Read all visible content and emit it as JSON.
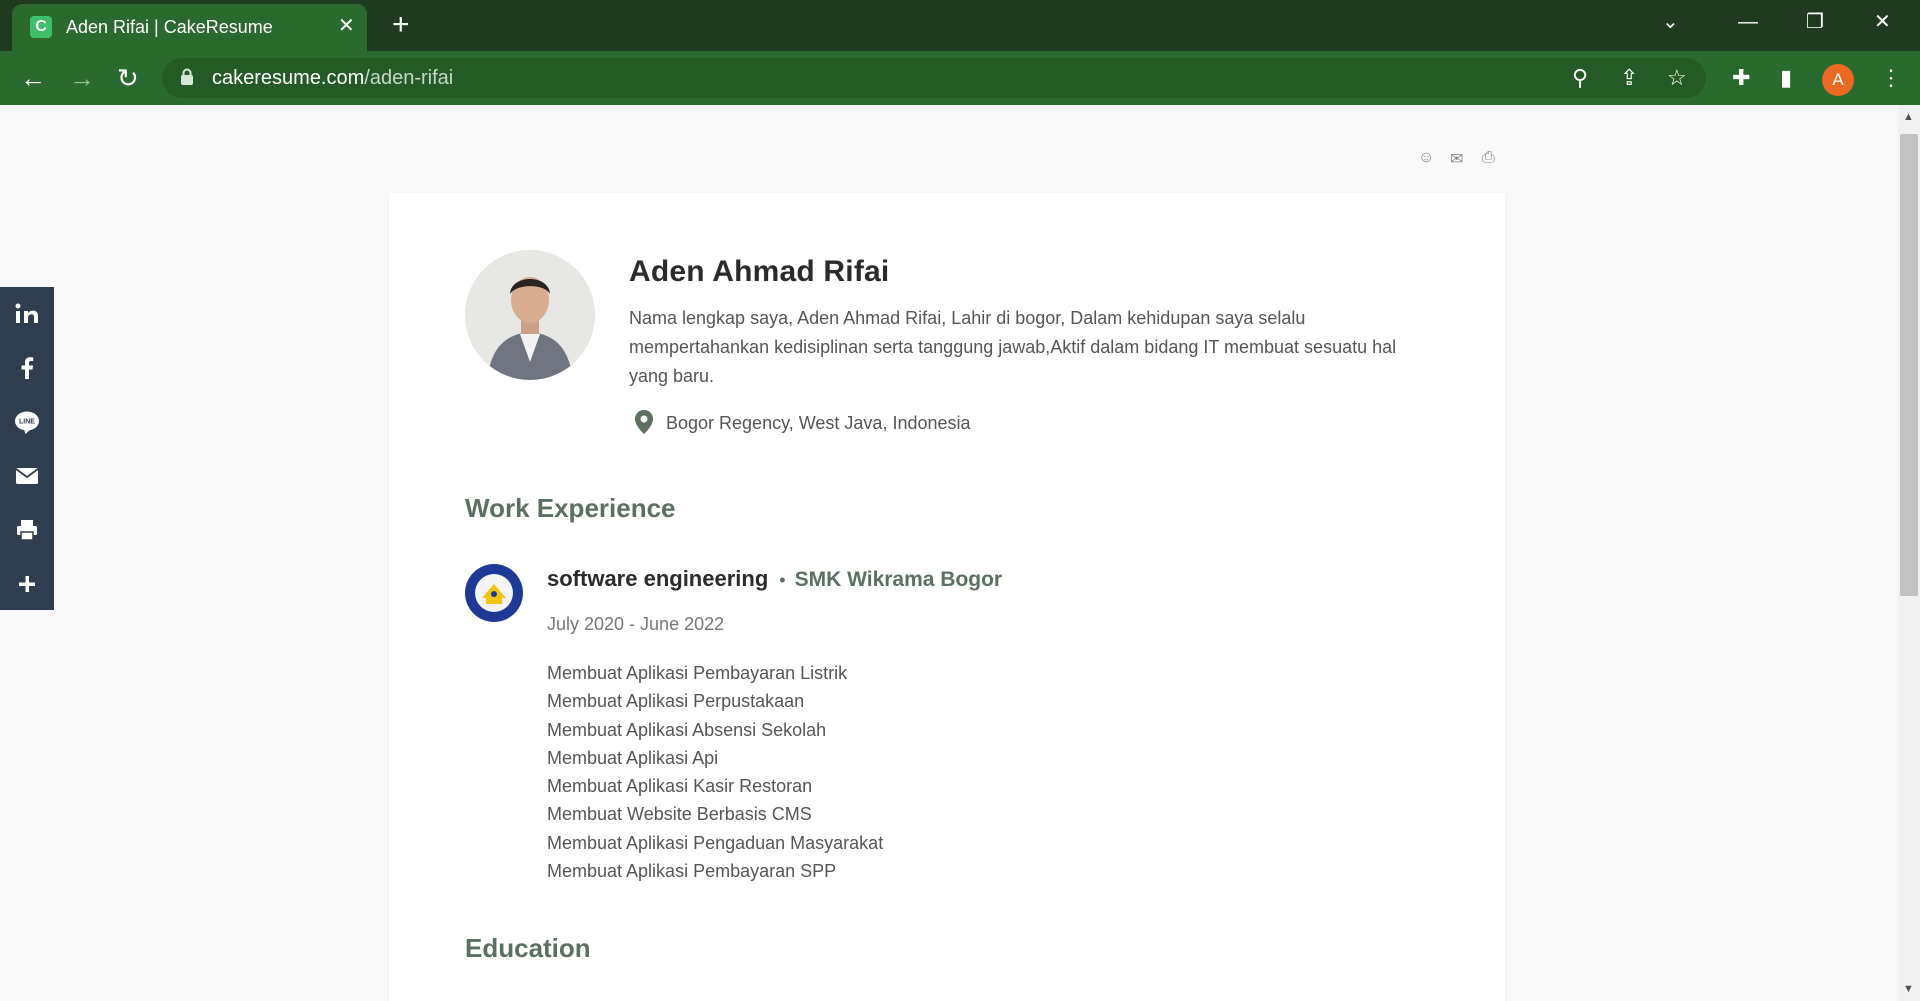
{
  "browser": {
    "tab_title": "Aden Rifai | CakeResume",
    "tab_favicon_letter": "C",
    "url_host": "cakeresume.com",
    "url_path": "/aden-rifai",
    "profile_initial": "A"
  },
  "profile": {
    "name": "Aden Ahmad Rifai",
    "bio": "Nama lengkap saya, Aden Ahmad Rifai, Lahir di bogor, Dalam kehidupan saya selalu mempertahankan kedisiplinan serta tanggung jawab,Aktif dalam bidang IT membuat sesuatu hal yang baru.",
    "location": "Bogor Regency, West Java, Indonesia"
  },
  "sections": {
    "work_title": "Work Experience",
    "education_title": "Education"
  },
  "job": {
    "title": "software engineering",
    "company": "SMK Wikrama Bogor",
    "dates": "July 2020 - June 2022",
    "duties": [
      "Membuat Aplikasi Pembayaran Listrik",
      "Membuat Aplikasi Perpustakaan",
      "Membuat Aplikasi Absensi Sekolah",
      "Membuat Aplikasi Api",
      "Membuat Aplikasi Kasir Restoran",
      "Membuat Website Berbasis CMS",
      "Membuat Aplikasi Pengaduan Masyarakat",
      "Membuat Aplikasi Pembayaran SPP"
    ]
  },
  "share_bar": {
    "items": [
      "linkedin-icon",
      "facebook-icon",
      "line-icon",
      "mail-icon",
      "print-icon",
      "plus-icon"
    ],
    "line_label": "LINE"
  },
  "colors": {
    "chrome_dark": "#1f3a1f",
    "chrome": "#2b6a2f",
    "accent_green": "#5c7061",
    "share_bar": "#2e3d4f",
    "avatar_orange": "#ea6a24"
  }
}
